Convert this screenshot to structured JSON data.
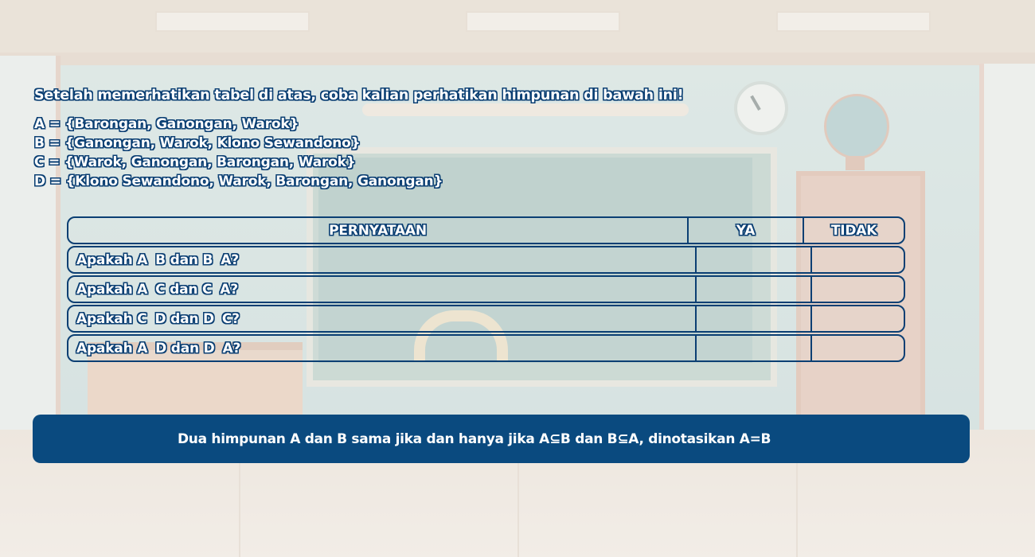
{
  "intro_text": "Setelah memerhatikan tabel di atas, coba kalian perhatikan himpunan di bawah ini!",
  "sets": [
    "A = {Barongan, Ganongan, Warok}",
    "B = {Ganongan, Warok, Klono Sewandono}",
    "C = {Warok, Ganongan, Barongan, Warok}",
    "D = {Klono Sewandono, Warok, Barongan, Ganongan}"
  ],
  "table": {
    "headers": [
      "PERNYATAAN",
      "YA",
      "TIDAK"
    ],
    "rows": [
      {
        "q1": "Apakah A",
        "mid": "B dan B",
        "q2": "A?",
        "ya": "",
        "tidak": ""
      },
      {
        "q1": "Apakah A",
        "mid": "C dan C",
        "q2": "A?",
        "ya": "",
        "tidak": ""
      },
      {
        "q1": "Apakah C",
        "mid": "D dan D",
        "q2": "C?",
        "ya": "",
        "tidak": ""
      },
      {
        "q1": "Apakah A",
        "mid": "D dan D",
        "q2": "A?",
        "ya": "",
        "tidak": ""
      }
    ]
  },
  "note": "Dua himpunan A dan B sama jika dan hanya jika A⊆B dan B⊆A, dinotasikan A=B",
  "colors": {
    "primary_blue": "#0a4a7f",
    "outline_blue": "#0b3f73",
    "text_white": "#ffffff"
  }
}
